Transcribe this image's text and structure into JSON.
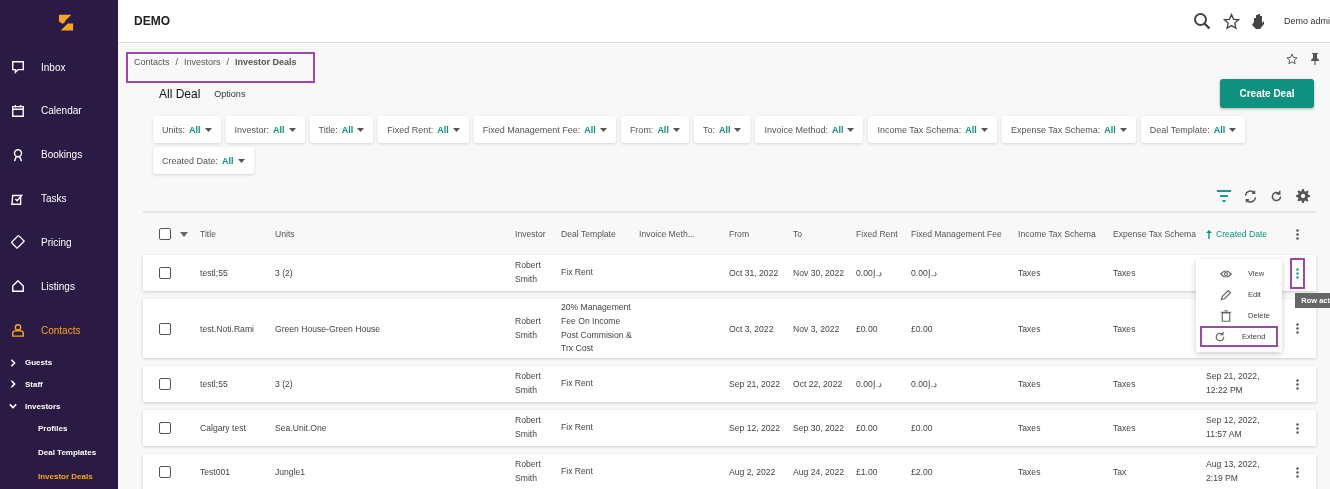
{
  "app": {
    "title": "DEMO",
    "user": "Demo admi"
  },
  "sidebar": {
    "items": [
      {
        "label": "Inbox",
        "selected": false
      },
      {
        "label": "Calendar",
        "selected": false
      },
      {
        "label": "Bookings",
        "selected": false
      },
      {
        "label": "Tasks",
        "selected": false
      },
      {
        "label": "Pricing",
        "selected": false
      },
      {
        "label": "Listings",
        "selected": false
      },
      {
        "label": "Contacts",
        "selected": true,
        "children": [
          {
            "label": "Guests",
            "expanded": false
          },
          {
            "label": "Staff",
            "expanded": false
          },
          {
            "label": "Investors",
            "expanded": true,
            "children": [
              {
                "label": "Profiles",
                "selected": false
              },
              {
                "label": "Deal Templates",
                "selected": false
              },
              {
                "label": "Investor Deals",
                "selected": true
              }
            ]
          }
        ]
      }
    ]
  },
  "breadcrumb": {
    "items": [
      "Contacts",
      "Investors",
      "Investor Deals"
    ],
    "separator": "/",
    "highlighted": true
  },
  "tabs": [
    {
      "label": "All Deal",
      "selected": true
    },
    {
      "label": "Options",
      "selected": false
    }
  ],
  "create_button": "Create Deal",
  "filters": [
    {
      "label": "Units:",
      "value": "All"
    },
    {
      "label": "Investor:",
      "value": "All"
    },
    {
      "label": "Title:",
      "value": "All"
    },
    {
      "label": "Fixed Rent:",
      "value": "All"
    },
    {
      "label": "Fixed Management Fee:",
      "value": "All"
    },
    {
      "label": "From:",
      "value": "All"
    },
    {
      "label": "To:",
      "value": "All"
    },
    {
      "label": "Invoice Method:",
      "value": "All"
    },
    {
      "label": "Income Tax Schema:",
      "value": "All"
    },
    {
      "label": "Expense Tax Schema:",
      "value": "All"
    },
    {
      "label": "Deal Template:",
      "value": "All"
    },
    {
      "label": "Created Date:",
      "value": "All"
    }
  ],
  "table": {
    "select_all": {
      "checked": false
    },
    "columns": [
      {
        "label": "Title",
        "sorted": false
      },
      {
        "label": "Units",
        "sorted": false
      },
      {
        "label": "Investor",
        "sorted": false
      },
      {
        "label": "Deal Template",
        "sorted": false
      },
      {
        "label": "Invoice Meth...",
        "sorted": false
      },
      {
        "label": "From",
        "sorted": false
      },
      {
        "label": "To",
        "sorted": false
      },
      {
        "label": "Fixed Rent",
        "sorted": false
      },
      {
        "label": "Fixed Management Fee",
        "sorted": false
      },
      {
        "label": "Income Tax Schema",
        "sorted": false
      },
      {
        "label": "Expense Tax Schema",
        "sorted": false
      },
      {
        "label": "Created Date",
        "sorted": true
      }
    ],
    "rows": [
      {
        "checked": false,
        "highlighted": true,
        "title": "testl;55",
        "units": "3 (2)",
        "investor": "Robert Smith",
        "deal_template": "Fix Rent",
        "from": "Oct 31, 2022",
        "to": "Nov 30, 2022",
        "fixed_rent": "0.00د.إ",
        "fixed_management_fee": "0.00د.إ",
        "income_tax_schema": "Taxes",
        "expense_tax_schema": "Taxes"
      },
      {
        "checked": false,
        "highlighted": false,
        "title": "test.Noti.Rami",
        "units": "Green House-Green House",
        "investor": "Robert Smith",
        "deal_template": "20% Management Fee On Income Post Commision & Trx Cost",
        "from": "Oct 3, 2022",
        "to": "Nov 3, 2022",
        "fixed_rent": "£0.00",
        "fixed_management_fee": "£0.00",
        "income_tax_schema": "Taxes",
        "expense_tax_schema": "Taxes"
      },
      {
        "checked": false,
        "highlighted": false,
        "title": "testl;55",
        "units": "3 (2)",
        "investor": "Robert Smith",
        "deal_template": "Fix Rent",
        "from": "Sep 21, 2022",
        "to": "Oct 22, 2022",
        "fixed_rent": "0.00د.إ",
        "fixed_management_fee": "0.00د.إ",
        "income_tax_schema": "Taxes",
        "expense_tax_schema": "Taxes",
        "created_date": "Sep 21, 2022, 12:22 PM"
      },
      {
        "checked": false,
        "highlighted": false,
        "title": "Calgary test",
        "units": "Sea.Unit.One",
        "investor": "Robert Smith",
        "deal_template": "Fix Rent",
        "from": "Sep 12, 2022",
        "to": "Sep 30, 2022",
        "fixed_rent": "£0.00",
        "fixed_management_fee": "£0.00",
        "income_tax_schema": "Taxes",
        "expense_tax_schema": "Taxes",
        "created_date": "Sep 12, 2022, 11:57 AM"
      },
      {
        "checked": false,
        "highlighted": false,
        "title": "Test001",
        "units": "Jungle1",
        "investor": "Robert Smith",
        "deal_template": "Fix Rent",
        "from": "Aug 2, 2022",
        "to": "Aug 24, 2022",
        "fixed_rent": "£1.00",
        "fixed_management_fee": "£2.00",
        "income_tax_schema": "Taxes",
        "expense_tax_schema": "Tax",
        "created_date": "Aug 13, 2022, 2:19 PM"
      }
    ]
  },
  "row_menu": {
    "items": [
      {
        "label": "View",
        "highlighted": false
      },
      {
        "label": "Edit",
        "highlighted": false
      },
      {
        "label": "Delete",
        "highlighted": false
      },
      {
        "label": "Extend",
        "highlighted": true
      }
    ],
    "tooltip": "Row act"
  }
}
